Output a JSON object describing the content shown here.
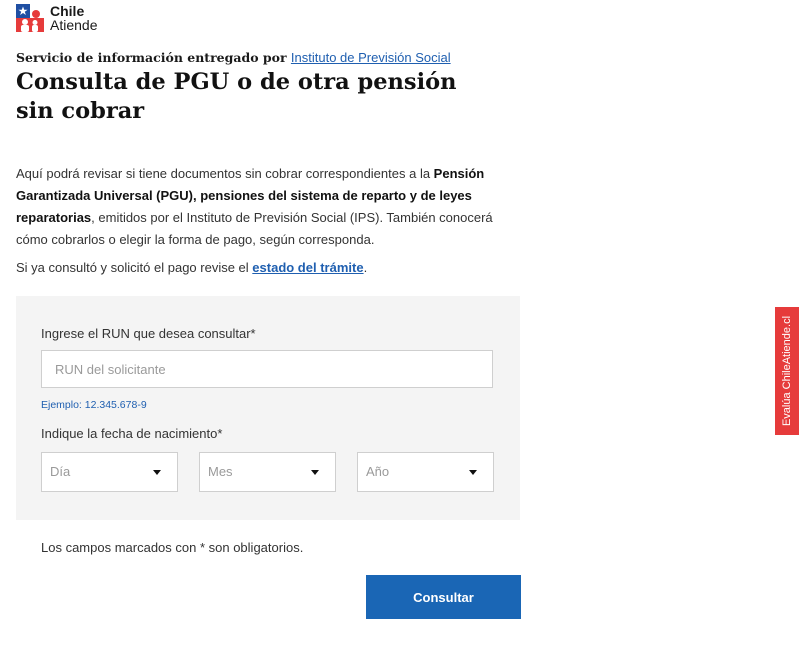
{
  "logo": {
    "line1": "Chile",
    "line2": "Atiende",
    "colors": {
      "blue": "#1f4fa3",
      "red": "#e63b3b"
    }
  },
  "provider": {
    "prefix": "Servicio de información entregado por",
    "link": "Instituto de Previsión Social"
  },
  "title": "Consulta de PGU o de otra pensión sin cobrar",
  "intro": {
    "p1_a": "Aquí podrá revisar si tiene documentos sin cobrar correspondientes a la ",
    "p1_bold": "Pensión Garantizada Universal (PGU), pensiones del sistema de reparto y de leyes reparatorias",
    "p1_b": ", emitidos por el Instituto de Previsión Social (IPS). También conocerá cómo cobrarlos o elegir la forma de pago, según corresponda.",
    "p2_a": "Si ya consultó y solicitó el pago revise el ",
    "p2_link": "estado del trámite",
    "p2_b": "."
  },
  "form": {
    "run_label": "Ingrese el RUN que desea consultar*",
    "run_placeholder": "RUN del solicitante",
    "run_hint": "Ejemplo: 12.345.678-9",
    "birth_label": "Indique la fecha de nacimiento*",
    "day_placeholder": "Día",
    "month_placeholder": "Mes",
    "year_placeholder": "Año"
  },
  "required_note": "Los campos marcados con * son obligatorios.",
  "submit_label": "Consultar",
  "feedback_tab": "Evalúa ChileAtiende.cl",
  "colors": {
    "primary_button": "#1a66b5",
    "link": "#1f5fb0",
    "feedback_tab": "#e63b3b",
    "card_bg": "#f4f4f4"
  }
}
